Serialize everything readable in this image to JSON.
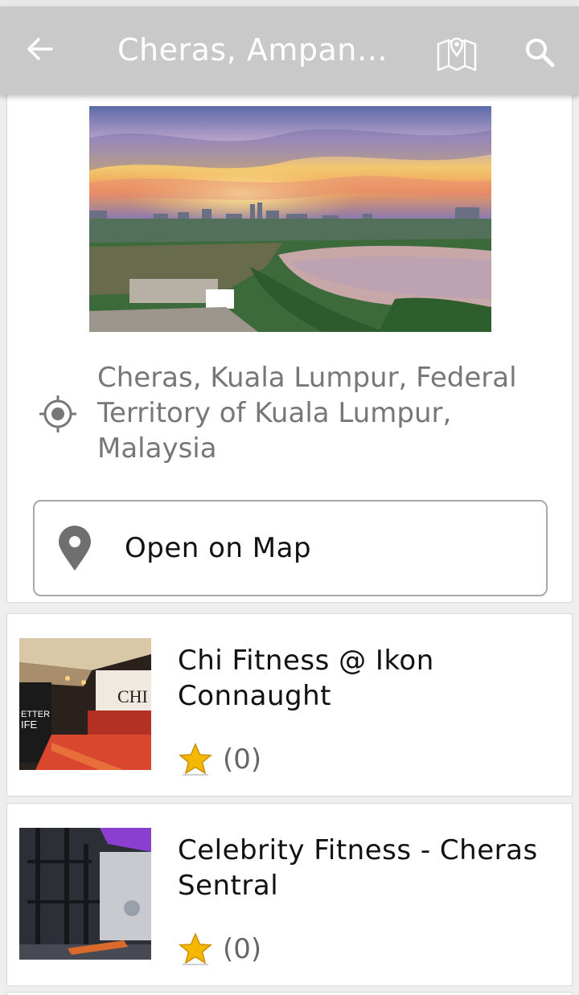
{
  "appbar": {
    "title": "Cheras, Ampan…",
    "back_icon": "arrow-back-icon",
    "map_icon": "map-marker-icon",
    "search_icon": "search-icon"
  },
  "location": {
    "hero_image": "city-skyline-sunset-lake-photo",
    "address": "Cheras, Kuala Lumpur, Federal Territory of Kuala Lumpur, Malaysia",
    "address_icon": "gps-target-icon",
    "open_map_label": "Open on Map",
    "open_map_icon": "map-pin-icon"
  },
  "places": [
    {
      "name": "Chi Fitness @ Ikon Connaught",
      "rating_count": "(0)",
      "thumbnail": "gym-reception-photo"
    },
    {
      "name": "Celebrity Fitness - Cheras Sentral",
      "rating_count": "(0)",
      "thumbnail": "gym-equipment-photo"
    }
  ],
  "colors": {
    "appbar": "#c9c9c9",
    "star": "#f5b800",
    "background": "#eeeeee"
  }
}
